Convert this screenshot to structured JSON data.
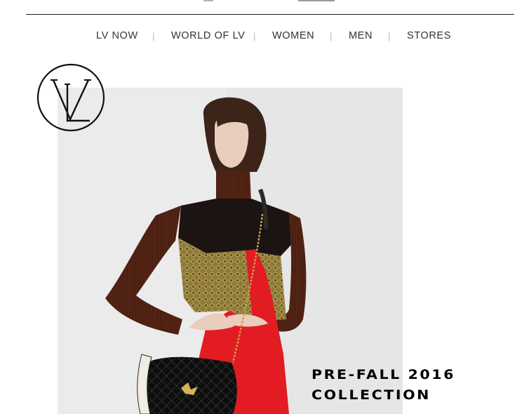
{
  "nav": {
    "items": [
      {
        "label": "LV NOW"
      },
      {
        "label": "WORLD OF LV"
      },
      {
        "label": "WOMEN"
      },
      {
        "label": "MEN"
      },
      {
        "label": "STORES"
      }
    ],
    "separator": "|"
  },
  "logo": {
    "text": "LV"
  },
  "hero": {
    "caption_line1": "PRE-FALL 2016",
    "caption_line2": "COLLECTION"
  },
  "colors": {
    "nav_text": "#333333",
    "separator": "#b9b9b9",
    "caption": "#000000",
    "dress_red": "#e31b23",
    "sweater_brown": "#4a1f12",
    "bag_black": "#111111"
  }
}
